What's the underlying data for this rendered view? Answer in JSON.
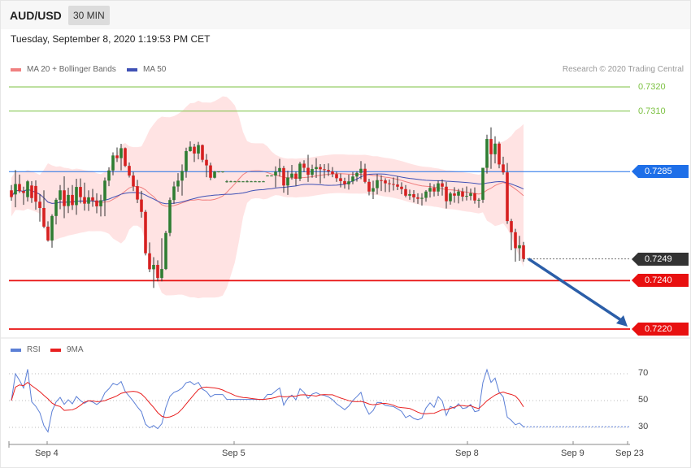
{
  "header": {
    "symbol": "AUD/USD",
    "timeframe": "30 MIN",
    "timestamp": "Tuesday, September 8, 2020 1:19:53 PM CET"
  },
  "legend": {
    "ma20": "MA 20 + Bollinger Bands",
    "ma50": "MA 50",
    "credit": "Research © 2020 Trading Central",
    "rsi": "RSI",
    "ma9": "9MA"
  },
  "colors": {
    "bullish": "#2e7d32",
    "bearish": "#d62020",
    "bollinger": "#ffe3e3",
    "ma20": "#f08080",
    "ma50": "#3f51b5",
    "resistance": "#7cc142",
    "pivot": "#1e6fe8",
    "support": "#e81010",
    "current": "#333333",
    "rsi": "#5b7fd6",
    "rsi_ma": "#e82020"
  },
  "chart_data": [
    {
      "type": "candlestick",
      "x_ticks": [
        "Sep 4",
        "Sep 5",
        "Sep 8",
        "Sep 9",
        "Sep 23"
      ],
      "levels": [
        {
          "value": "0.7320",
          "kind": "resistance"
        },
        {
          "value": "0.7310",
          "kind": "resistance"
        },
        {
          "value": "0.7285",
          "kind": "pivot"
        },
        {
          "value": "0.7249",
          "kind": "current"
        },
        {
          "value": "0.7240",
          "kind": "support"
        },
        {
          "value": "0.7220",
          "kind": "support"
        }
      ],
      "ylim": [
        0.7215,
        0.7325
      ],
      "ohlc": [
        [
          0.72773,
          0.72795,
          0.7273,
          0.72745
        ],
        [
          0.72756,
          0.72857,
          0.72703,
          0.72799
        ],
        [
          0.72799,
          0.72838,
          0.72762,
          0.7277
        ],
        [
          0.7277,
          0.72788,
          0.72713,
          0.72762
        ],
        [
          0.72745,
          0.72815,
          0.72727,
          0.7281
        ],
        [
          0.72793,
          0.72811,
          0.72721,
          0.72741
        ],
        [
          0.72791,
          0.72814,
          0.72693,
          0.72726
        ],
        [
          0.72726,
          0.72757,
          0.72644,
          0.727
        ],
        [
          0.727,
          0.72773,
          0.72617,
          0.72623
        ],
        [
          0.72623,
          0.72645,
          0.72561,
          0.72566
        ],
        [
          0.72566,
          0.72674,
          0.72536,
          0.72667
        ],
        [
          0.72667,
          0.72741,
          0.72632,
          0.72734
        ],
        [
          0.72734,
          0.72795,
          0.72695,
          0.72773
        ],
        [
          0.72773,
          0.72831,
          0.72658,
          0.72708
        ],
        [
          0.72708,
          0.72784,
          0.72679,
          0.72754
        ],
        [
          0.72754,
          0.72795,
          0.72692,
          0.72712
        ],
        [
          0.72712,
          0.72821,
          0.72672,
          0.72787
        ],
        [
          0.72787,
          0.72822,
          0.72719,
          0.72745
        ],
        [
          0.72745,
          0.72805,
          0.72689,
          0.72718
        ],
        [
          0.72718,
          0.72773,
          0.72688,
          0.72744
        ],
        [
          0.72744,
          0.72779,
          0.72705,
          0.72731
        ],
        [
          0.72731,
          0.72761,
          0.72678,
          0.72707
        ],
        [
          0.72707,
          0.72755,
          0.72665,
          0.72732
        ],
        [
          0.72732,
          0.72826,
          0.72666,
          0.72813
        ],
        [
          0.72813,
          0.72868,
          0.7279,
          0.72855
        ],
        [
          0.72855,
          0.7293,
          0.72835,
          0.72917
        ],
        [
          0.72917,
          0.7295,
          0.7289,
          0.72906
        ],
        [
          0.72906,
          0.72965,
          0.72855,
          0.72947
        ],
        [
          0.72947,
          0.7295,
          0.72869,
          0.72874
        ],
        [
          0.72874,
          0.72888,
          0.72826,
          0.72834
        ],
        [
          0.72834,
          0.72849,
          0.7277,
          0.7279
        ],
        [
          0.7279,
          0.72816,
          0.7272,
          0.72735
        ],
        [
          0.72735,
          0.72771,
          0.7266,
          0.72684
        ],
        [
          0.72684,
          0.72692,
          0.72504,
          0.72513
        ],
        [
          0.72513,
          0.72558,
          0.72435,
          0.72447
        ],
        [
          0.72447,
          0.72497,
          0.7237,
          0.72465
        ],
        [
          0.72465,
          0.72484,
          0.72397,
          0.72411
        ],
        [
          0.72411,
          0.72575,
          0.72397,
          0.72448
        ],
        [
          0.72448,
          0.72606,
          0.72444,
          0.72597
        ],
        [
          0.72597,
          0.72743,
          0.72584,
          0.72733
        ],
        [
          0.72733,
          0.72809,
          0.72717,
          0.72789
        ],
        [
          0.72789,
          0.72844,
          0.72767,
          0.72813
        ],
        [
          0.72813,
          0.7288,
          0.72751,
          0.72853
        ],
        [
          0.72853,
          0.72949,
          0.72825,
          0.72935
        ],
        [
          0.72935,
          0.72975,
          0.72933,
          0.72953
        ],
        [
          0.72953,
          0.72965,
          0.7289,
          0.72925
        ],
        [
          0.72925,
          0.72973,
          0.72901,
          0.7296
        ],
        [
          0.7296,
          0.72962,
          0.72889,
          0.72899
        ],
        [
          0.72899,
          0.72923,
          0.72827,
          0.72876
        ],
        [
          0.72876,
          0.72887,
          0.72815,
          0.72825
        ],
        [
          0.72825,
          0.72853,
          0.72822,
          0.72851
        ],
        [
          0.72851,
          0.72851,
          0.72847,
          0.72851
        ],
        [
          0.72851,
          0.72851,
          0.72846,
          0.72851
        ],
        [
          0.7281,
          0.72815,
          0.72805,
          0.7281
        ],
        [
          0.7281,
          0.72813,
          0.72807,
          0.7281
        ],
        [
          0.7281,
          0.72812,
          0.72809,
          0.7281
        ],
        [
          0.7281,
          0.72812,
          0.72808,
          0.7281
        ],
        [
          0.7281,
          0.72811,
          0.72807,
          0.7281
        ],
        [
          0.7281,
          0.72814,
          0.72806,
          0.7281
        ],
        [
          0.7281,
          0.72812,
          0.72808,
          0.7281
        ],
        [
          0.7281,
          0.72812,
          0.72808,
          0.7281
        ],
        [
          0.7281,
          0.72811,
          0.72806,
          0.7281
        ],
        [
          0.7281,
          0.72812,
          0.72809,
          0.7281
        ],
        [
          0.72834,
          0.72835,
          0.72832,
          0.72834
        ],
        [
          0.72834,
          0.72835,
          0.72832,
          0.72834
        ],
        [
          0.72834,
          0.72872,
          0.72785,
          0.7285
        ],
        [
          0.7285,
          0.72903,
          0.7283,
          0.72865
        ],
        [
          0.72865,
          0.72874,
          0.72763,
          0.72793
        ],
        [
          0.72793,
          0.72854,
          0.72754,
          0.72826
        ],
        [
          0.72826,
          0.72878,
          0.72817,
          0.72842
        ],
        [
          0.72842,
          0.72851,
          0.72792,
          0.72821
        ],
        [
          0.72821,
          0.72891,
          0.72811,
          0.72883
        ],
        [
          0.72883,
          0.72897,
          0.72848,
          0.72866
        ],
        [
          0.72866,
          0.7292,
          0.72808,
          0.72837
        ],
        [
          0.72837,
          0.72879,
          0.72825,
          0.72861
        ],
        [
          0.72861,
          0.72906,
          0.72824,
          0.72869
        ],
        [
          0.72869,
          0.72881,
          0.72801,
          0.7286
        ],
        [
          0.7286,
          0.72881,
          0.72823,
          0.72857
        ],
        [
          0.72857,
          0.72884,
          0.72832,
          0.72851
        ],
        [
          0.72851,
          0.72869,
          0.72827,
          0.7284
        ],
        [
          0.7284,
          0.7285,
          0.72808,
          0.72823
        ],
        [
          0.72823,
          0.72842,
          0.72785,
          0.72811
        ],
        [
          0.72811,
          0.72825,
          0.7278,
          0.72798
        ],
        [
          0.72798,
          0.72838,
          0.72776,
          0.7281
        ],
        [
          0.7281,
          0.72849,
          0.72798,
          0.7283
        ],
        [
          0.7283,
          0.72852,
          0.72809,
          0.72845
        ],
        [
          0.72845,
          0.72894,
          0.72819,
          0.72862
        ],
        [
          0.72862,
          0.72883,
          0.72802,
          0.72808
        ],
        [
          0.72808,
          0.72821,
          0.72752,
          0.72768
        ],
        [
          0.72768,
          0.72813,
          0.72737,
          0.72782
        ],
        [
          0.72782,
          0.7284,
          0.72756,
          0.72815
        ],
        [
          0.72815,
          0.72835,
          0.7277,
          0.72814
        ],
        [
          0.72814,
          0.72823,
          0.72766,
          0.72802
        ],
        [
          0.72802,
          0.72818,
          0.72766,
          0.72799
        ],
        [
          0.72799,
          0.72826,
          0.72772,
          0.72797
        ],
        [
          0.72797,
          0.72831,
          0.72774,
          0.72788
        ],
        [
          0.72788,
          0.72806,
          0.72757,
          0.72778
        ],
        [
          0.72778,
          0.72795,
          0.72744,
          0.72751
        ],
        [
          0.72751,
          0.72776,
          0.72734,
          0.72757
        ],
        [
          0.72757,
          0.72774,
          0.72723,
          0.72744
        ],
        [
          0.72744,
          0.72761,
          0.72717,
          0.72738
        ],
        [
          0.72738,
          0.72761,
          0.7271,
          0.72742
        ],
        [
          0.72742,
          0.72774,
          0.72726,
          0.72768
        ],
        [
          0.72768,
          0.72803,
          0.72743,
          0.72783
        ],
        [
          0.72783,
          0.72798,
          0.72748,
          0.72768
        ],
        [
          0.72768,
          0.72814,
          0.7275,
          0.72802
        ],
        [
          0.72802,
          0.72818,
          0.72751,
          0.72788
        ],
        [
          0.72788,
          0.72808,
          0.72698,
          0.72728
        ],
        [
          0.72728,
          0.72767,
          0.72714,
          0.7276
        ],
        [
          0.7276,
          0.72786,
          0.72722,
          0.72751
        ],
        [
          0.72751,
          0.72779,
          0.72719,
          0.72768
        ],
        [
          0.72768,
          0.72783,
          0.72728,
          0.72747
        ],
        [
          0.72747,
          0.72789,
          0.72731,
          0.7275
        ],
        [
          0.7275,
          0.7278,
          0.72732,
          0.72761
        ],
        [
          0.72761,
          0.72785,
          0.72718,
          0.72731
        ],
        [
          0.72731,
          0.72741,
          0.72701,
          0.72734
        ],
        [
          0.72734,
          0.72839,
          0.72721,
          0.72866
        ],
        [
          0.72866,
          0.73003,
          0.72842,
          0.72985
        ],
        [
          0.72985,
          0.73033,
          0.72862,
          0.72922
        ],
        [
          0.72922,
          0.72996,
          0.72884,
          0.72966
        ],
        [
          0.72966,
          0.72974,
          0.72864,
          0.7288
        ],
        [
          0.7288,
          0.72912,
          0.72838,
          0.72847
        ],
        [
          0.72847,
          0.72886,
          0.72634,
          0.72646
        ],
        [
          0.72646,
          0.72655,
          0.72526,
          0.726
        ],
        [
          0.726,
          0.72614,
          0.72478,
          0.72534
        ],
        [
          0.72534,
          0.72585,
          0.72482,
          0.72546
        ],
        [
          0.72546,
          0.7256,
          0.72478,
          0.7249
        ]
      ]
    },
    {
      "type": "line",
      "series": [
        {
          "name": "RSI"
        },
        {
          "name": "9MA"
        }
      ],
      "y_ticks": [
        "70",
        "50",
        "30"
      ],
      "ylim": [
        20,
        80
      ]
    }
  ]
}
